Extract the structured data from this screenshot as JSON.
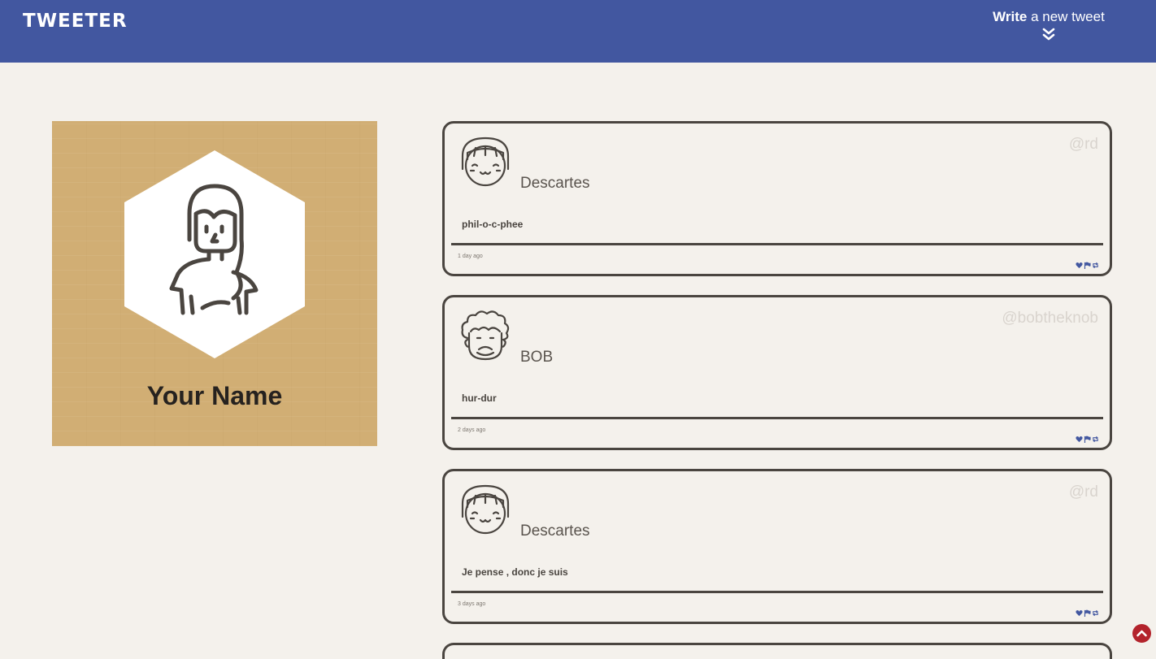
{
  "header": {
    "brand": "TWEETER",
    "compose_bold": "Write",
    "compose_rest": " a new tweet",
    "compose_icon": "double-chevron-down-icon",
    "background_color": "#4257a0"
  },
  "profile": {
    "name": "Your Name",
    "avatar_icon": "woman-avatar-icon",
    "background_color": "#d1ae74"
  },
  "tweets": [
    {
      "author": "Descartes",
      "handle": "@rd",
      "avatar_icon": "girl-bangs-avatar-icon",
      "content": "phil-o-c-phee",
      "time": "1 day ago"
    },
    {
      "author": "BOB",
      "handle": "@bobtheknob",
      "avatar_icon": "curly-hair-avatar-icon",
      "content": "hur-dur",
      "time": "2 days ago"
    },
    {
      "author": "Descartes",
      "handle": "@rd",
      "avatar_icon": "girl-bangs-avatar-icon",
      "content": "Je pense , donc je suis",
      "time": "3 days ago"
    }
  ],
  "actions": [
    "heart-icon",
    "flag-icon",
    "retweet-icon"
  ],
  "scroll_to_top_icon": "chevron-up-icon",
  "colors": {
    "page": "#f4f1ec",
    "ink": "#4a4540",
    "action": "#4257a0",
    "scroll_button": "#b3232c"
  }
}
